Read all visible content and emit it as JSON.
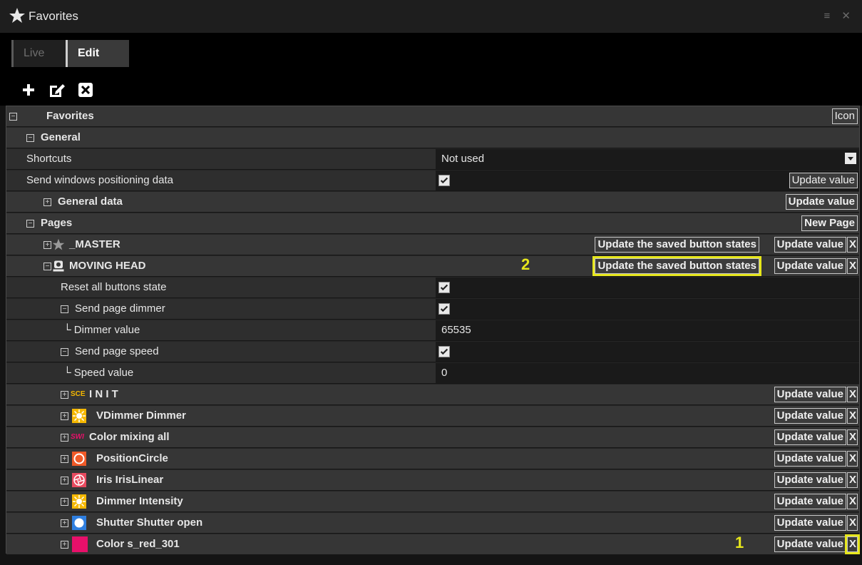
{
  "window": {
    "title": "Favorites",
    "controls": "≡ ✕"
  },
  "tabs": [
    {
      "label": "Live"
    },
    {
      "label": "Edit"
    }
  ],
  "root": {
    "label": "Favorites",
    "icon_button": "Icon"
  },
  "general": {
    "label": "General",
    "shortcuts": {
      "label": "Shortcuts",
      "value": "Not used"
    },
    "send_windows": {
      "label": "Send windows positioning data",
      "button": "Update value"
    },
    "general_data": {
      "label": "General data",
      "button": "Update value"
    }
  },
  "pages": {
    "label": "Pages",
    "new_page_button": "New Page",
    "master": {
      "label": "_MASTER",
      "save_states": "Update the saved button states",
      "update": "Update value",
      "delete": "X"
    },
    "moving_head": {
      "label": "MOVING HEAD",
      "save_states": "Update the saved button states",
      "update": "Update value",
      "delete": "X",
      "reset_all": {
        "label": "Reset all buttons state"
      },
      "send_dimmer": {
        "label": "Send page dimmer"
      },
      "dimmer_value": {
        "label": "└ Dimmer value",
        "value": "65535"
      },
      "send_speed": {
        "label": "Send page speed"
      },
      "speed_value": {
        "label": "└ Speed value",
        "value": "0"
      },
      "items": [
        {
          "label": "I N I T",
          "icon": "sce-text-icon",
          "icon_text": "SCE",
          "update": "Update value",
          "delete": "X"
        },
        {
          "label": "VDimmer Dimmer",
          "icon": "sun-icon",
          "update": "Update value",
          "delete": "X"
        },
        {
          "label": "Color mixing all",
          "icon": "sw-text-icon",
          "icon_text": "SWI",
          "update": "Update value",
          "delete": "X"
        },
        {
          "label": "PositionCircle",
          "icon": "circle-icon",
          "update": "Update value",
          "delete": "X"
        },
        {
          "label": "Iris IrisLinear",
          "icon": "iris-icon",
          "update": "Update value",
          "delete": "X"
        },
        {
          "label": "Dimmer Intensity",
          "icon": "sun-icon",
          "update": "Update value",
          "delete": "X"
        },
        {
          "label": "Shutter Shutter open",
          "icon": "shutter-icon",
          "update": "Update value",
          "delete": "X"
        },
        {
          "label": "Color s_red_301",
          "icon": "color-swatch-icon",
          "update": "Update value",
          "delete": "X"
        }
      ]
    }
  },
  "annotations": {
    "marker_1": "1",
    "marker_2": "2"
  },
  "colors": {
    "accent_highlight": "#e6e61c",
    "swatch_red": "#e8106a",
    "sun_yellow": "#f5b800",
    "circle_orange": "#f05a28"
  }
}
